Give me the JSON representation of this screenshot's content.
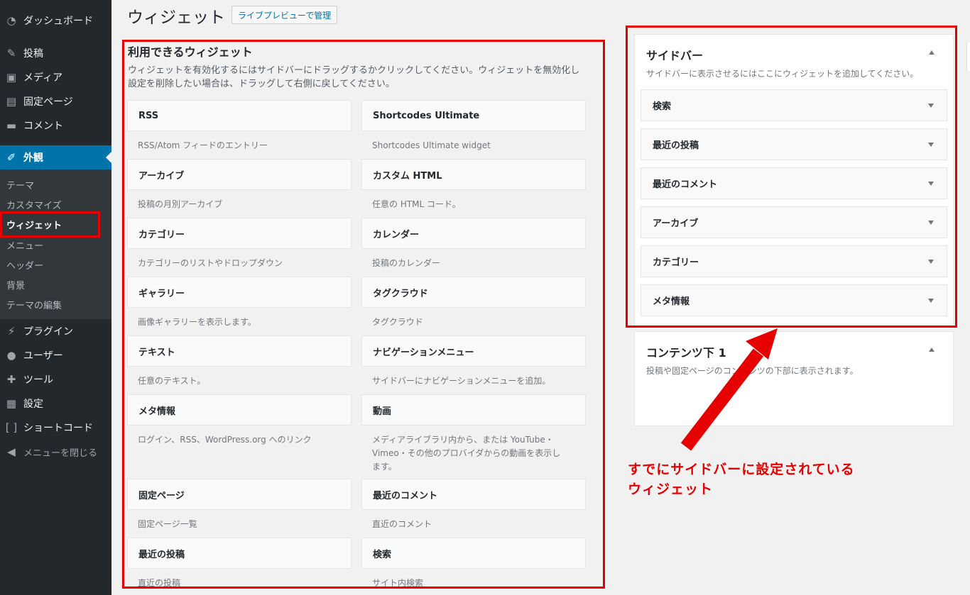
{
  "menu": {
    "dashboard": "ダッシュボード",
    "posts": "投稿",
    "media": "メディア",
    "pages": "固定ページ",
    "comments": "コメント",
    "appearance": "外観",
    "plugins": "プラグイン",
    "users": "ユーザー",
    "tools": "ツール",
    "settings": "設定",
    "shortcodes": "ショートコード",
    "collapse": "メニューを閉じる"
  },
  "submenu": [
    "テーマ",
    "カスタマイズ",
    "ウィジェット",
    "メニュー",
    "ヘッダー",
    "背景",
    "テーマの編集"
  ],
  "header": {
    "title": "ウィジェット",
    "live_preview": "ライブプレビューで管理"
  },
  "available": {
    "title": "利用できるウィジェット",
    "desc_line1": "ウィジェットを有効化するにはサイドバーにドラッグするかクリックしてください。ウィジェットを無効化し",
    "desc_line2": "設定を削除したい場合は、ドラッグして右側に戻してください。",
    "widgets": [
      {
        "name": "RSS",
        "desc": "RSS/Atom フィードのエントリー"
      },
      {
        "name": "Shortcodes Ultimate",
        "desc": "Shortcodes Ultimate widget"
      },
      {
        "name": "アーカイブ",
        "desc": "投稿の月別アーカイブ"
      },
      {
        "name": "カスタム HTML",
        "desc": "任意の HTML コード。"
      },
      {
        "name": "カテゴリー",
        "desc": "カテゴリーのリストやドロップダウン"
      },
      {
        "name": "カレンダー",
        "desc": "投稿のカレンダー"
      },
      {
        "name": "ギャラリー",
        "desc": "画像ギャラリーを表示します。"
      },
      {
        "name": "タグクラウド",
        "desc": "タグクラウド"
      },
      {
        "name": "テキスト",
        "desc": "任意のテキスト。"
      },
      {
        "name": "ナビゲーションメニュー",
        "desc": "サイドバーにナビゲーションメニューを追加。"
      },
      {
        "name": "メタ情報",
        "desc": "ログイン、RSS、WordPress.org へのリンク"
      },
      {
        "name": "動画",
        "desc": "メディアライブラリ内から、または YouTube・Vimeo・その他のプロバイダからの動画を表示します。"
      },
      {
        "name": "固定ページ",
        "desc": "固定ページ一覧"
      },
      {
        "name": "最近のコメント",
        "desc": "直近のコメント"
      },
      {
        "name": "最近の投稿",
        "desc": "直近の投稿"
      },
      {
        "name": "検索",
        "desc": "サイト内検索"
      }
    ]
  },
  "sidebar_area": {
    "title": "サイドバー",
    "desc": "サイドバーに表示させるにはここにウィジェットを追加してください。",
    "widgets": [
      "検索",
      "最近の投稿",
      "最近のコメント",
      "アーカイブ",
      "カテゴリー",
      "メタ情報"
    ]
  },
  "content_area": {
    "title": "コンテンツ下 1",
    "desc": "投稿や固定ページのコンテンツの下部に表示されます。"
  },
  "annotation": {
    "line1": "すでにサイドバーに設定されている",
    "line2": "ウィジェット"
  },
  "colors": {
    "annotation_red": "#e60000",
    "admin_blue": "#0073aa",
    "admin_dark": "#23282d"
  }
}
